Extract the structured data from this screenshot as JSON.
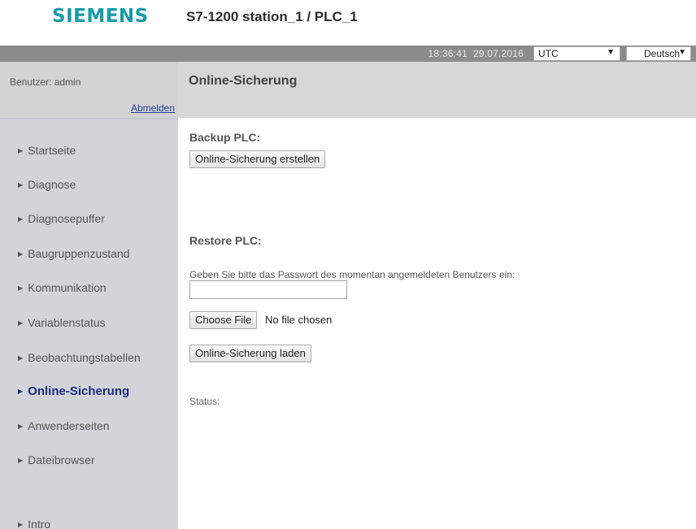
{
  "header": {
    "logo": "SIEMENS",
    "station": "S7-1200 station_1 / PLC_1"
  },
  "topbar": {
    "time": "18:36:41",
    "date": "29.07.2016",
    "timezone": "UTC",
    "language": "Deutsch"
  },
  "user": {
    "label": "Benutzer: admin",
    "logout": "Abmelden"
  },
  "page": {
    "title": "Online-Sicherung"
  },
  "nav": {
    "items": [
      {
        "label": "Startseite",
        "active": false
      },
      {
        "label": "Diagnose",
        "active": false
      },
      {
        "label": "Diagnosepuffer",
        "active": false
      },
      {
        "label": "Baugruppenzustand",
        "active": false
      },
      {
        "label": "Kommunikation",
        "active": false
      },
      {
        "label": "Variablenstatus",
        "active": false
      },
      {
        "label": "Beobachtungstabellen",
        "active": false
      },
      {
        "label": "Online-Sicherung",
        "active": true
      },
      {
        "label": "Anwenderseiten",
        "active": false
      },
      {
        "label": "Dateibrowser",
        "active": false
      },
      {
        "label": "Intro",
        "active": false
      }
    ]
  },
  "backup": {
    "title": "Backup PLC:",
    "create_button": "Online-Sicherung erstellen"
  },
  "restore": {
    "title": "Restore PLC:",
    "password_prompt": "Geben Sie bitte das Passwort des momentan angemeldeten Benutzers ein:",
    "password_value": "",
    "choose_file_button": "Choose File",
    "file_status": "No file chosen",
    "load_button": "Online-Sicherung laden",
    "status_label": "Status:"
  },
  "colors": {
    "brand": "#189ba7",
    "active_nav": "#1f2a7a",
    "link": "#2a3d9a"
  }
}
